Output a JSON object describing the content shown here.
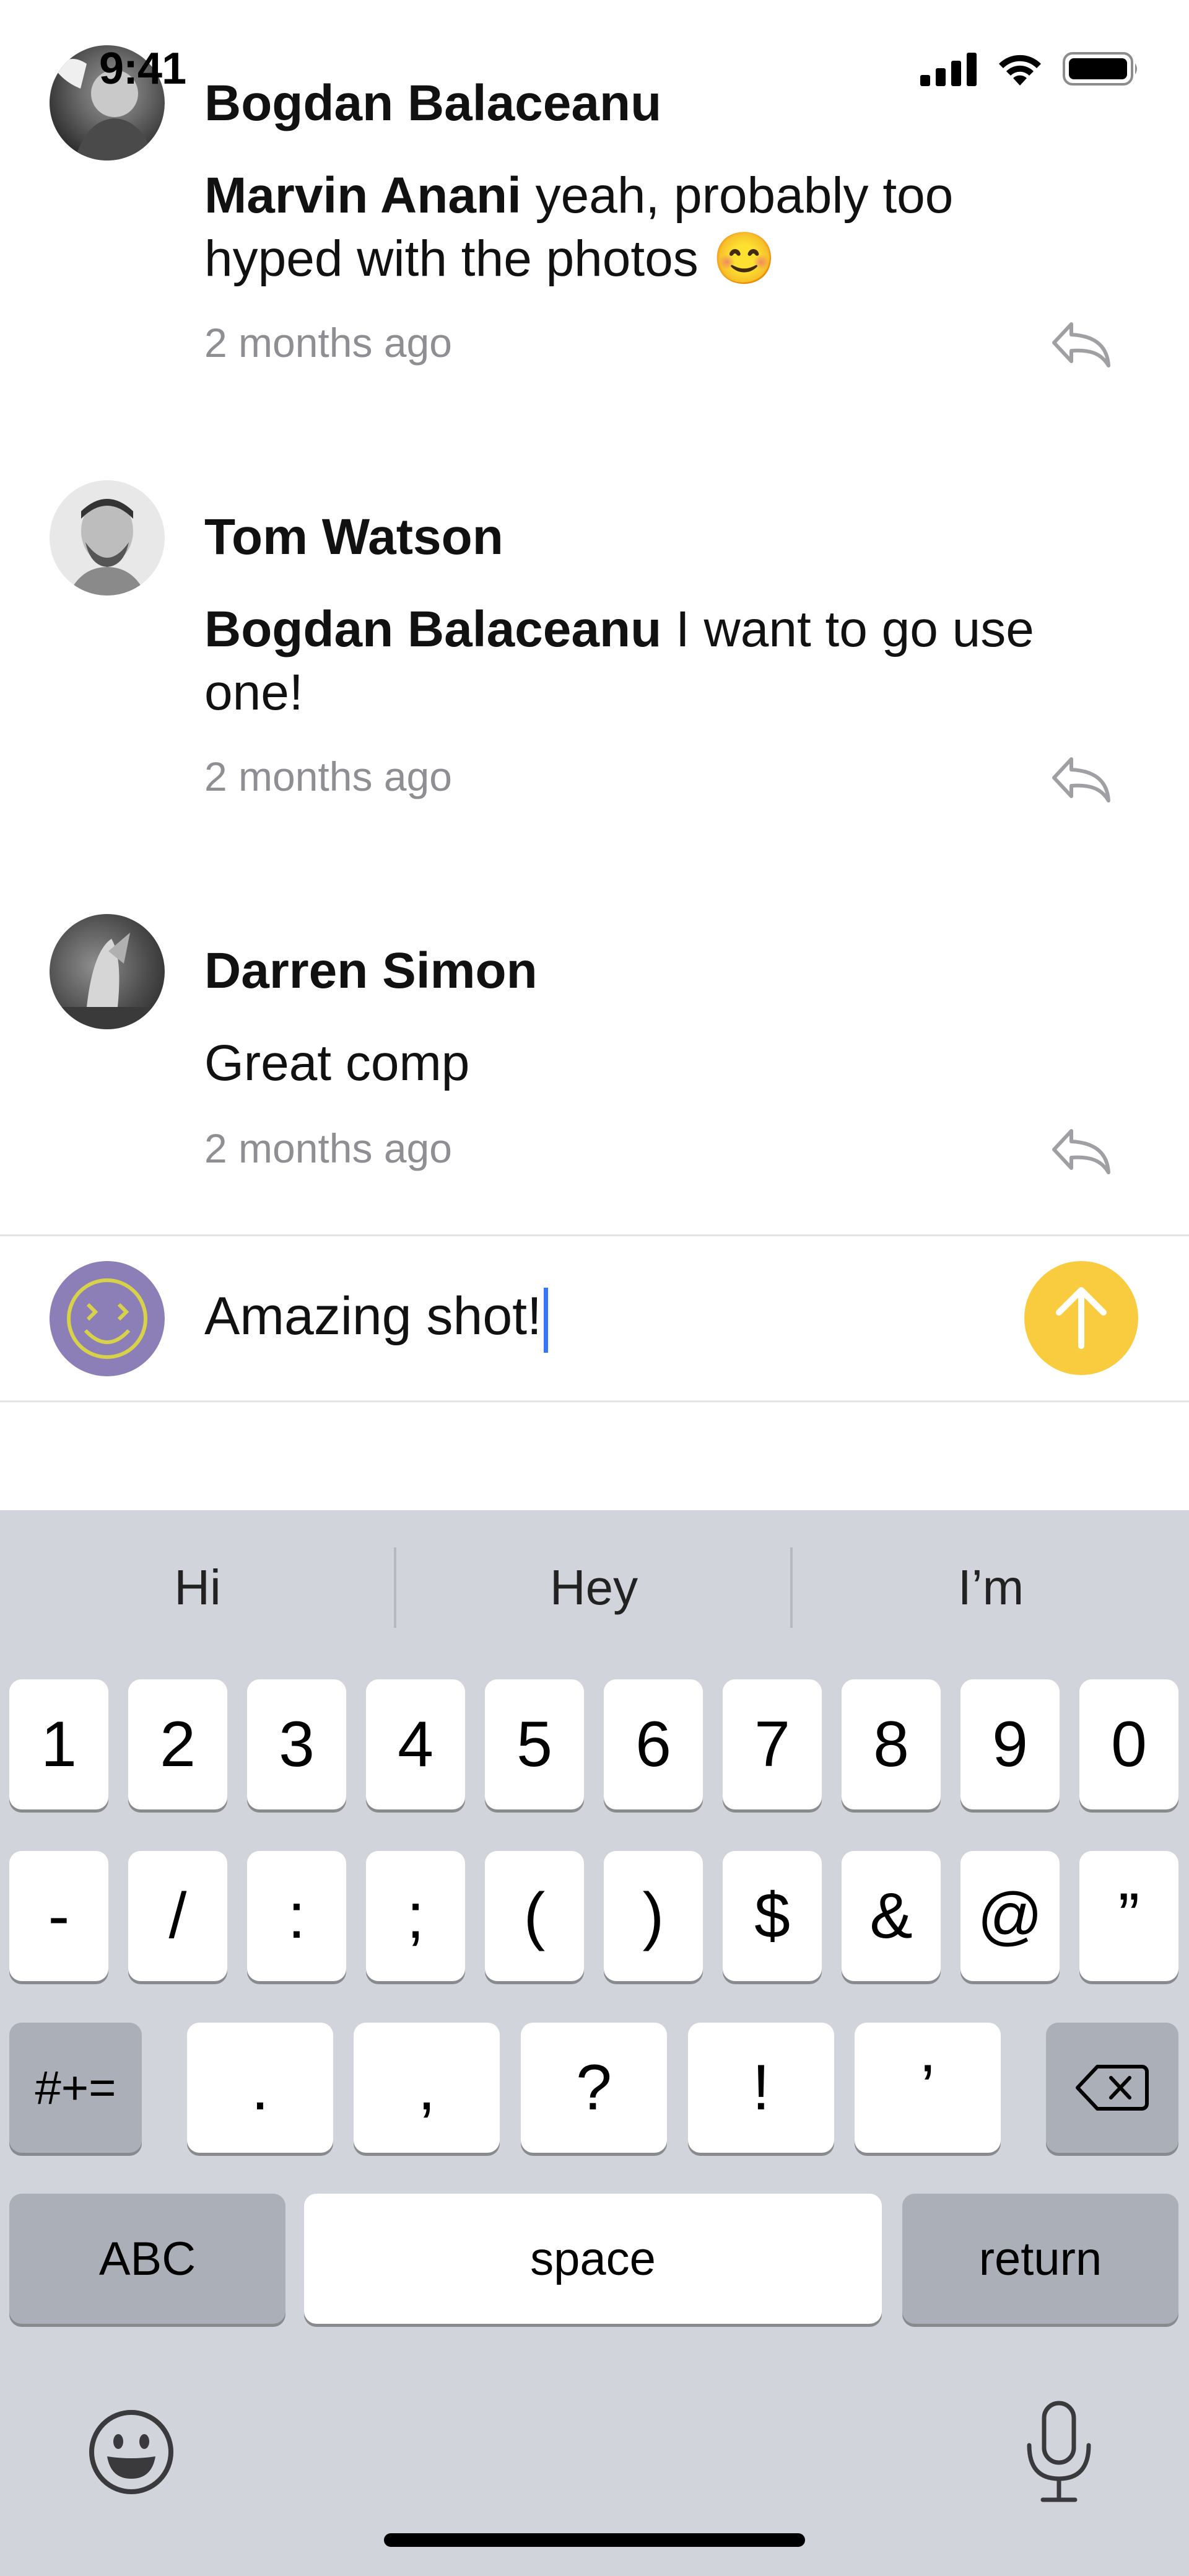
{
  "status_bar": {
    "time": "9:41"
  },
  "comments": [
    {
      "author": "Bogdan Balaceanu",
      "mention": "Marvin Anani",
      "text": " yeah, probably too hyped with the photos 😊",
      "time": "2 months ago"
    },
    {
      "author": "Tom Watson",
      "mention": "Bogdan Balaceanu",
      "text": " I want to go use one!",
      "time": "2 months ago"
    },
    {
      "author": "Darren Simon",
      "mention": "",
      "text": "Great comp",
      "time": "2 months ago"
    }
  ],
  "composer": {
    "value": "Amazing shot!"
  },
  "keyboard": {
    "predictions": [
      "Hi",
      "Hey",
      "I’m"
    ],
    "row1": [
      "1",
      "2",
      "3",
      "4",
      "5",
      "6",
      "7",
      "8",
      "9",
      "0"
    ],
    "row2": [
      "-",
      "/",
      ":",
      ";",
      "(",
      ")",
      "$",
      "&",
      "@",
      "”"
    ],
    "row3_mode": "#+=",
    "row3": [
      ".",
      ",",
      "?",
      "!",
      "’"
    ],
    "abc": "ABC",
    "space": "space",
    "return": "return"
  },
  "colors": {
    "send_button": "#f8cc3e",
    "caret": "#3478f6",
    "keyboard_bg": "#d1d4db"
  },
  "icons": [
    "cellular-signal-icon",
    "wifi-icon",
    "battery-icon",
    "reply-icon",
    "send-arrow-icon",
    "backspace-icon",
    "emoji-icon",
    "microphone-icon"
  ]
}
